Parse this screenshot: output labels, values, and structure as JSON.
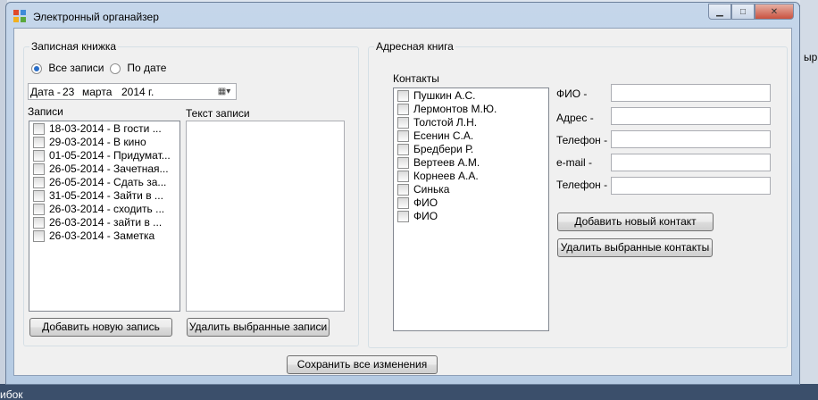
{
  "window": {
    "title": "Электронный органайзер"
  },
  "background": {
    "left_text": "",
    "right_text": "ыр",
    "bottom_text": "ибок"
  },
  "notebook": {
    "group_label": "Записная книжка",
    "filter": {
      "all_label": "Все записи",
      "by_date_label": "По дате",
      "selected": "all"
    },
    "date_label": "Дата -",
    "date_value": {
      "day": "23",
      "month": "марта",
      "year": "2014 г."
    },
    "entries_label": "Записи",
    "entry_text_label": "Текст записи",
    "entries": [
      "18-03-2014 - В гости ...",
      "29-03-2014 - В кино",
      "01-05-2014 - Придумат...",
      "26-05-2014 - Зачетная...",
      "26-05-2014 - Сдать за...",
      "31-05-2014 - Зайти в ...",
      "26-03-2014 - сходить ...",
      "26-03-2014 - зайти в ...",
      "26-03-2014 - Заметка"
    ],
    "entry_text": "",
    "add_button": "Добавить новую запись",
    "delete_button": "Удалить выбранные записи"
  },
  "address_book": {
    "group_label": "Адресная книга",
    "contacts_label": "Контакты",
    "contacts": [
      "Пушкин А.С.",
      "Лермонтов М.Ю.",
      "Толстой Л.Н.",
      "Есенин С.А.",
      "Бредбери Р.",
      "Вертеев А.М.",
      "Корнеев А.А.",
      "Синька",
      "ФИО",
      "ФИО"
    ],
    "fields": {
      "fio_label": "ФИО -",
      "address_label": "Адрес -",
      "phone_label": "Телефон -",
      "email_label": "e-mail -",
      "phone2_label": "Телефон -"
    },
    "add_contact_button": "Добавить новый контакт",
    "delete_contacts_button": "Удалить выбранные контакты"
  },
  "save_button": "Сохранить все изменения"
}
